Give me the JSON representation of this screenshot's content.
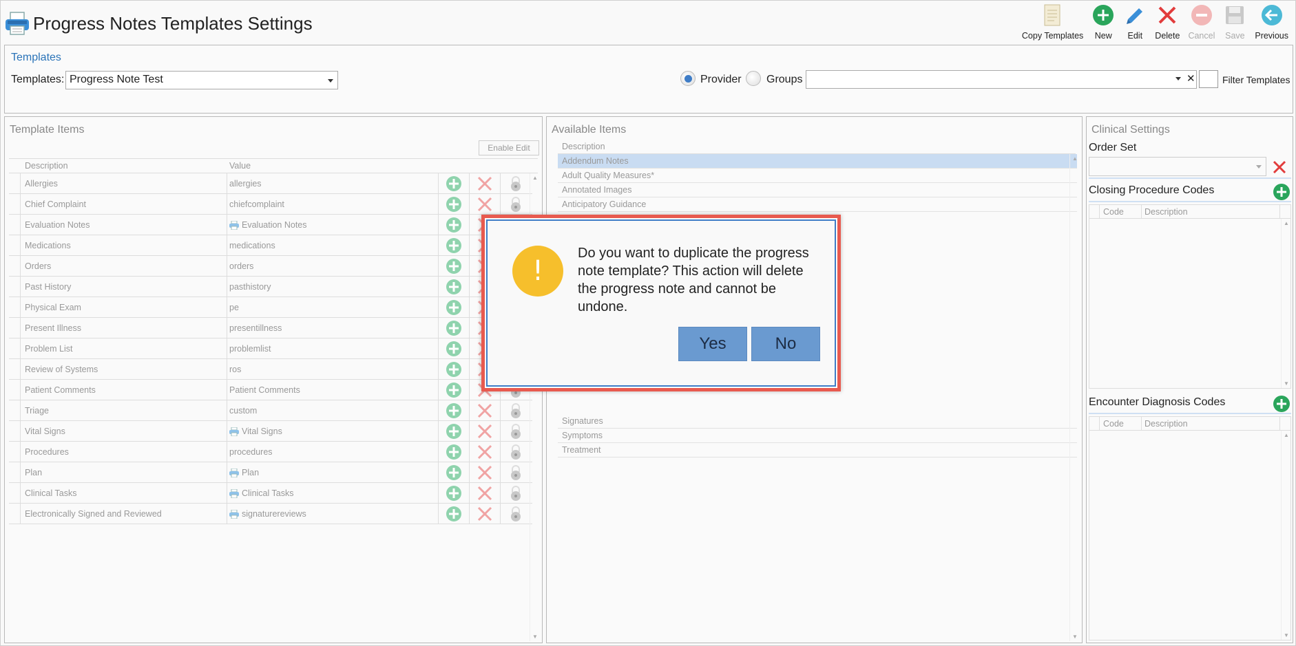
{
  "window": {
    "title": "Progress Notes Templates Settings"
  },
  "toolbar": {
    "copy_templates": "Copy Templates",
    "new": "New",
    "edit": "Edit",
    "delete": "Delete",
    "cancel": "Cancel",
    "save": "Save",
    "previous": "Previous"
  },
  "templates": {
    "heading": "Templates",
    "label": "Templates:",
    "selected": "Progress Note Test",
    "provider_label": "Provider",
    "groups_label": "Groups",
    "group_clear": "✕",
    "filter_label": "Filter Templates"
  },
  "template_items": {
    "title": "Template Items",
    "enable_edit": "Enable Edit",
    "columns": {
      "description": "Description",
      "value": "Value"
    },
    "rows": [
      {
        "description": "Allergies",
        "value": "allergies",
        "icon": false
      },
      {
        "description": "Chief Complaint",
        "value": "chiefcomplaint",
        "icon": false
      },
      {
        "description": "Evaluation Notes",
        "value": "Evaluation Notes",
        "icon": true
      },
      {
        "description": "Medications",
        "value": "medications",
        "icon": false
      },
      {
        "description": "Orders",
        "value": "orders",
        "icon": false
      },
      {
        "description": "Past History",
        "value": "pasthistory",
        "icon": false
      },
      {
        "description": "Physical Exam",
        "value": "pe",
        "icon": false
      },
      {
        "description": "Present Illness",
        "value": "presentillness",
        "icon": false
      },
      {
        "description": "Problem List",
        "value": "problemlist",
        "icon": false
      },
      {
        "description": "Review of Systems",
        "value": "ros",
        "icon": false
      },
      {
        "description": "Patient Comments",
        "value": "Patient Comments",
        "icon": false
      },
      {
        "description": "Triage",
        "value": "custom",
        "icon": false
      },
      {
        "description": "Vital Signs",
        "value": "Vital Signs",
        "icon": true
      },
      {
        "description": "Procedures",
        "value": "procedures",
        "icon": false
      },
      {
        "description": "Plan",
        "value": "Plan",
        "icon": true
      },
      {
        "description": "Clinical Tasks",
        "value": "Clinical Tasks",
        "icon": true
      },
      {
        "description": "Electronically Signed and Reviewed",
        "value": "signaturereviews",
        "icon": true
      }
    ]
  },
  "available_items": {
    "title": "Available Items",
    "column": "Description",
    "rows_top": [
      "Addendum Notes",
      "Adult Quality Measures*",
      "Annotated Images",
      "Anticipatory Guidance"
    ],
    "rows_bottom": [
      "Signatures",
      "Symptoms",
      "Treatment"
    ]
  },
  "clinical_settings": {
    "title": "Clinical Settings",
    "order_set_label": "Order Set",
    "closing_codes_label": "Closing Procedure Codes",
    "encounter_codes_label": "Encounter Diagnosis Codes",
    "code_col": "Code",
    "desc_col": "Description"
  },
  "dialog": {
    "icon": "!",
    "message": "Do you want to duplicate the progress note template? This action will delete the progress note and cannot be undone.",
    "yes": "Yes",
    "no": "No"
  },
  "colors": {
    "accent_blue": "#3e7cc6",
    "dialog_border": "#e85a4f",
    "warning": "#f6bf2c",
    "add_green": "#2aa55b",
    "delete_red": "#e23c3c"
  }
}
